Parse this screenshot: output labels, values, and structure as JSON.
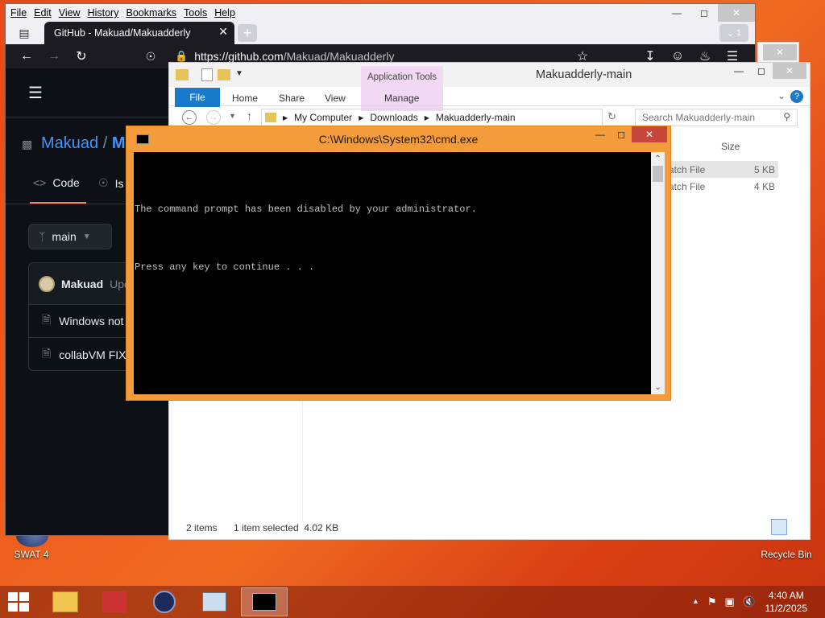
{
  "desktop": {
    "icons": [
      {
        "label": "SWAT 4"
      },
      {
        "label": "Recycle Bin"
      }
    ]
  },
  "firefox": {
    "menu": [
      "File",
      "Edit",
      "View",
      "History",
      "Bookmarks",
      "Tools",
      "Help"
    ],
    "tab_title": "GitHub - Makuad/Makuadderly",
    "tab_count": "1",
    "url_host": "https://github.com",
    "url_path": "/Makuad/Makuadderly",
    "github": {
      "owner": "Makuad",
      "sep": "/",
      "repo_initial": "M",
      "code_tab": "Code",
      "issues_tab": "Is",
      "branch": "main",
      "commit_author": "Makuad",
      "commit_msg": "Upc",
      "files": [
        "Windows not",
        "collabVM FIX"
      ]
    }
  },
  "explorer": {
    "title": "Makuadderly-main",
    "app_tools": "Application Tools",
    "ribbon_tabs": [
      "File",
      "Home",
      "Share",
      "View",
      "Manage"
    ],
    "breadcrumb": [
      "My Computer",
      "Downloads",
      "Makuadderly-main"
    ],
    "search_placeholder": "Search Makuadderly-main",
    "size_header": "Size",
    "rows": [
      {
        "type": "atch File",
        "size": "5 KB"
      },
      {
        "type": "atch File",
        "size": "4 KB"
      }
    ],
    "status_items": "2 items",
    "status_selected": "1 item selected  4.02 KB"
  },
  "cmd": {
    "title": "C:\\Windows\\System32\\cmd.exe",
    "lines": [
      "The command prompt has been disabled by your administrator.",
      "Press any key to continue . . ."
    ]
  },
  "taskbar": {
    "time": "4:40 AM",
    "date": "11/2/2025"
  }
}
